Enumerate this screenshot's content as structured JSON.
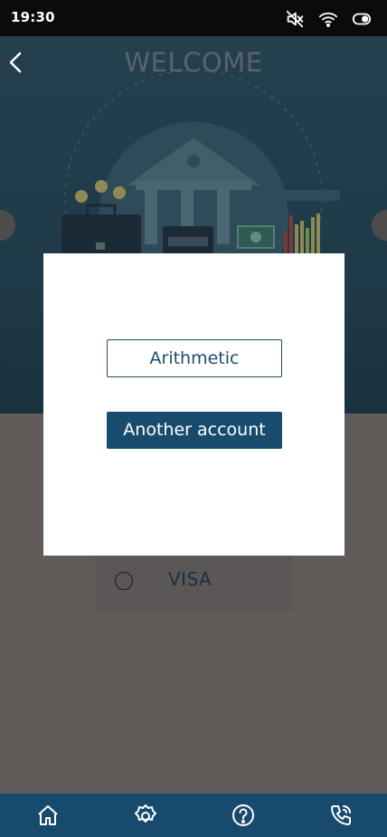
{
  "status_bar": {
    "time": "19:30",
    "icons": [
      "mute-icon",
      "wifi-icon",
      "toggle-icon"
    ]
  },
  "header": {
    "title": "WELCOME",
    "back_icon": "chevron-left-icon"
  },
  "dialog": {
    "option_1_label": "Arithmetic",
    "option_2_label": "Another account"
  },
  "payment_option": {
    "label": "VISA",
    "selected": false
  },
  "bottom_nav": {
    "items": [
      "home-icon",
      "gear-icon",
      "help-icon",
      "phone-icon"
    ]
  },
  "colors": {
    "primary": "#184a6d",
    "hero_bg": "#24404f",
    "overlay_bg": "#615b5a",
    "status_bar": "#0b0b0b"
  }
}
